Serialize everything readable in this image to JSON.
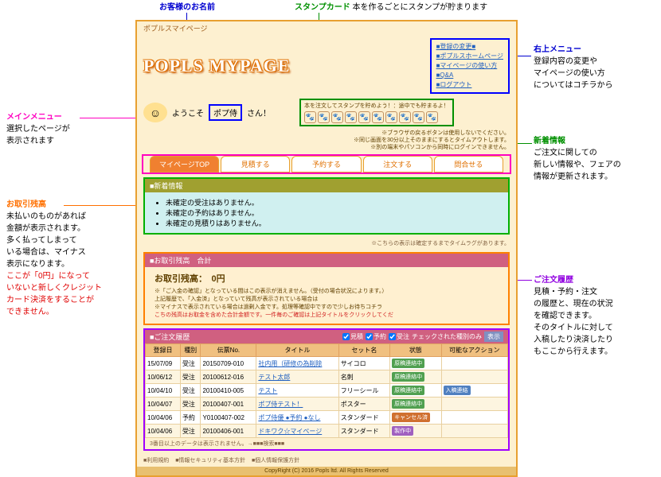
{
  "top_title": "ポプルスマイページ",
  "logo": "POPLS MYPAGE",
  "rmenu": [
    "■登録の変更■",
    "■ポプルスホームページ",
    "■マイページの使い方",
    "■Q&A",
    "■ログアウト"
  ],
  "greeting_prefix": "ようこそ",
  "username": "ポプ侍",
  "greeting_suffix": "さん！",
  "stamp_title": "本を注文してスタンプを貯めよう！：途中でも貯まるよ！",
  "top_notes": [
    "※ブラウザの戻るボタンは使用しないでください。",
    "※同じ画面を30分以上そのままにするとタイムアウトします。",
    "※別の端末やパソコンから同時にログインできません。"
  ],
  "tabs": [
    "マイページTOP",
    "見積する",
    "予約する",
    "注文する",
    "問合せる"
  ],
  "news": {
    "title": "■新着情報",
    "items": [
      "未確定の受注はありません。",
      "未確定の予約はありません。",
      "未確定の見積りはありません。"
    ],
    "foot": "※こちらの表示は確定するまでタイムラグがあります。"
  },
  "balance": {
    "title": "■お取引残高　合計",
    "label": "お取引残高：",
    "amount": "0円",
    "notes": [
      "※「ご入金の確認」となっている間はこの表示が消えません。（受付の場合状況によります。）",
      "上記履歴で、「入金済」となっていて残高が表示されている場合は",
      "※マイナスで表示されている場合は過剰入金です。処理等確認中ですので少しお待ちコチラ"
    ],
    "note_red": "こちの残高はお取金を含めた合計金額です。一件毎のご確認は上記タイトルをクリックしてくだ"
  },
  "history": {
    "title": "■ご注文履歴",
    "filters": [
      "見積",
      "予約",
      "受注"
    ],
    "filter_label": "チェックされた種別のみ",
    "filter_btn": "表示",
    "cols": [
      "登録日",
      "種別",
      "伝票No.",
      "タイトル",
      "セット名",
      "状態",
      "可能なアクション"
    ],
    "rows": [
      {
        "d": "15/07/09",
        "k": "受注",
        "no": "20150709-010",
        "t": "社内用（研修の為削除",
        "s": "サイコロ",
        "st": "原稿連絡中",
        "a": ""
      },
      {
        "d": "10/06/12",
        "k": "受注",
        "no": "20100612-016",
        "t": "テスト太郎",
        "s": "名刺",
        "st": "原稿連絡中",
        "a": ""
      },
      {
        "d": "10/04/10",
        "k": "受注",
        "no": "20100410-005",
        "t": "テスト",
        "s": "フリーシール",
        "st": "原稿連絡中",
        "a": "入稿連絡"
      },
      {
        "d": "10/04/07",
        "k": "受注",
        "no": "20100407-001",
        "t": "ポプ侍テスト！",
        "s": "ポスター",
        "st": "原稿連絡中",
        "a": ""
      },
      {
        "d": "10/04/06",
        "k": "予約",
        "no": "Y0100407-002",
        "t": "ポプ侍優 ●予約 ●なし",
        "s": "スタンダード",
        "st": "キャンセル済",
        "a": ""
      },
      {
        "d": "10/04/06",
        "k": "受注",
        "no": "20100406-001",
        "t": "ドキワク☆マイページ",
        "s": "スタンダード",
        "st": "製作中",
        "a": ""
      }
    ],
    "foot": "3番目以上のデータは表示されません。→■■■検索■■■"
  },
  "footer_links": [
    "■利用規約",
    "■情報セキュリティ基本方針",
    "■個人情報保護方針"
  ],
  "copyright": "CopyRight (C) 2016 Popls ltd. All Rights Reserved",
  "annotations": {
    "name": {
      "t": "お客様のお名前"
    },
    "stamp": {
      "t": "スタンプカード",
      "d": "本を作るごとにスタンプが貯まります"
    },
    "rmenu": {
      "t": "右上メニュー",
      "d": "登録内容の変更や\nマイページの使い方\nについてはコチラから"
    },
    "main": {
      "t": "メインメニュー",
      "d": "選択したページが\n表示されます"
    },
    "news": {
      "t": "新着情報",
      "d": "ご注文に関しての\n新しい情報や、フェアの\n情報が更新されます。"
    },
    "bal": {
      "t": "お取引残高",
      "d": "未払いのものがあれば\n金額が表示されます。\n多く払ってしまって\nいる場合は、マイナス\n表示になります。",
      "r": "ここが「0円」になって\nいないと新しくクレジット\nカード決済をすることが\nできません。"
    },
    "hist": {
      "t": "ご注文履歴",
      "d": "見積・予約・注文\nの履歴と、現在の状況\nを確認できます。\nそのタイトルに対して\n入稿したり決済したり\nもここから行えます。"
    }
  }
}
